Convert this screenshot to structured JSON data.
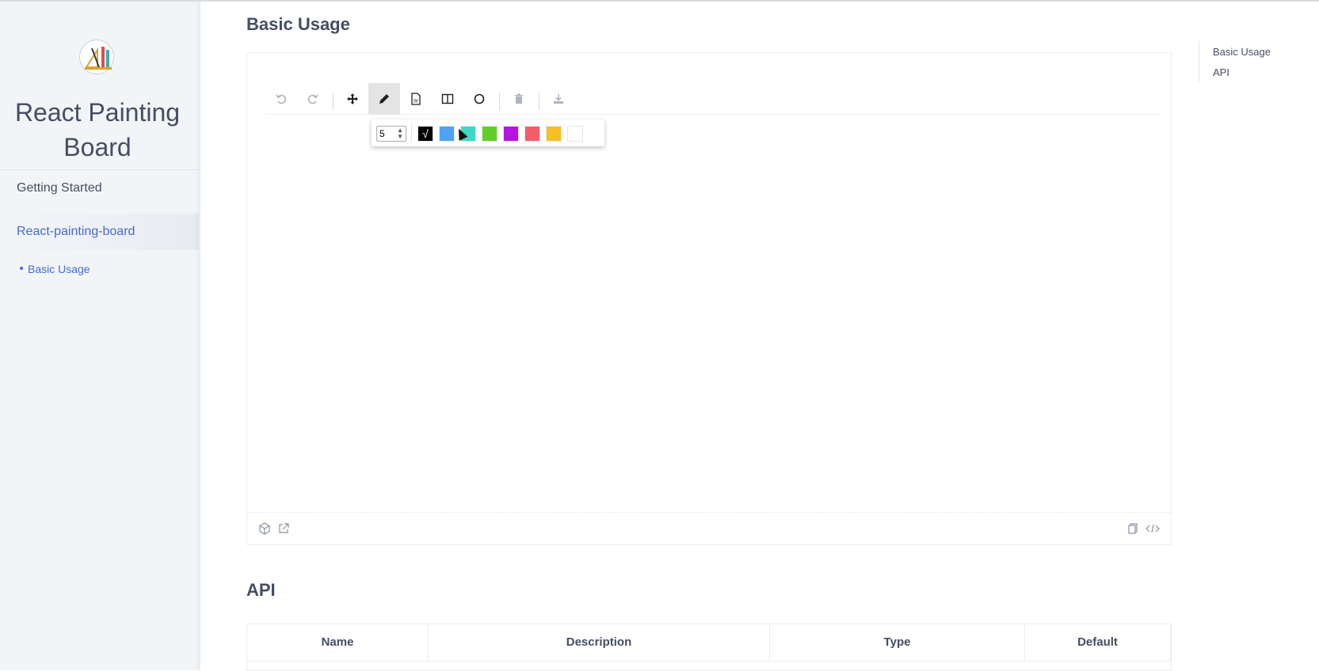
{
  "sidebar": {
    "site_title_line1": "React Painting",
    "site_title_line2": "Board",
    "nav": [
      {
        "label": "Getting Started"
      },
      {
        "label": "React-painting-board"
      }
    ],
    "subnav": [
      {
        "label": "Basic Usage"
      }
    ]
  },
  "main": {
    "section_basic_title": "Basic Usage",
    "section_api_title": "API",
    "toolbar": {
      "buttons": [
        {
          "icon": "undo-icon",
          "state": "disabled"
        },
        {
          "icon": "redo-icon",
          "state": "disabled"
        },
        {
          "icon": "move-icon",
          "state": "enabled"
        },
        {
          "icon": "pencil-icon",
          "state": "active"
        },
        {
          "icon": "text-document-icon",
          "state": "enabled"
        },
        {
          "icon": "layout-columns-icon",
          "state": "enabled"
        },
        {
          "icon": "circle-icon",
          "state": "enabled"
        },
        {
          "icon": "trash-icon",
          "state": "disabled"
        },
        {
          "icon": "download-icon",
          "state": "disabled"
        }
      ]
    },
    "brush_popover": {
      "width_value": "5",
      "colors": [
        "#000000",
        "#4fa3f5",
        "#3fd8c4",
        "#5fd02b",
        "#b514e3",
        "#f45d6b",
        "#f8bf25",
        "#ffffff"
      ],
      "selected_color": "#000000",
      "check_glyph": "√"
    },
    "api_table": {
      "headers": [
        "Name",
        "Description",
        "Type",
        "Default"
      ]
    }
  },
  "toc": {
    "items": [
      {
        "label": "Basic Usage"
      },
      {
        "label": "API"
      }
    ]
  }
}
